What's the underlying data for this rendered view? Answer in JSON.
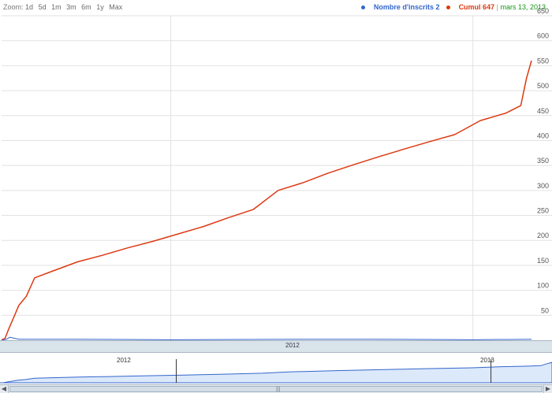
{
  "header": {
    "zoom_label": "Zoom:",
    "zoom_options": [
      "1d",
      "5d",
      "1m",
      "3m",
      "6m",
      "1y",
      "Max"
    ]
  },
  "legend": {
    "series": [
      {
        "label": "Nombre d'inscrits 2",
        "color": "#3366cc"
      },
      {
        "label": "Cumul 647",
        "color": "#dc3912"
      }
    ],
    "date": "mars 13, 2013"
  },
  "colors": {
    "grid": "#e2e2e2",
    "axis_text": "#555555",
    "overview_fill": "#dce9fb"
  },
  "main_axis": {
    "year_label": "2012"
  },
  "overview": {
    "labels": [
      "2012",
      "2013"
    ]
  },
  "chart_data": {
    "type": "line",
    "title": "",
    "xlabel": "",
    "ylabel": "",
    "ylim": [
      0,
      650
    ],
    "yticks": [
      50,
      100,
      150,
      200,
      250,
      300,
      350,
      400,
      450,
      500,
      550,
      600,
      650
    ],
    "grid": true,
    "legend_position": "top-right",
    "x_range": [
      "2011-06-10",
      "2013-03-13"
    ],
    "series": [
      {
        "name": "Cumul",
        "color": "#dc3912",
        "x": [
          "2011-06-10",
          "2011-06-14",
          "2011-06-18",
          "2011-07-01",
          "2011-07-10",
          "2011-07-20",
          "2011-08-10",
          "2011-09-10",
          "2011-10-10",
          "2011-11-10",
          "2011-12-10",
          "2012-01-10",
          "2012-02-10",
          "2012-03-10",
          "2012-04-10",
          "2012-05-10",
          "2012-06-10",
          "2012-07-10",
          "2012-08-10",
          "2012-09-10",
          "2012-10-10",
          "2012-11-10",
          "2012-12-10",
          "2013-01-10",
          "2013-02-10",
          "2013-02-28",
          "2013-03-07",
          "2013-03-13"
        ],
        "values": [
          1,
          3,
          20,
          70,
          88,
          125,
          138,
          157,
          170,
          185,
          198,
          213,
          228,
          245,
          262,
          300,
          316,
          335,
          352,
          368,
          383,
          398,
          412,
          440,
          455,
          470,
          525,
          560
        ],
        "linewidth": 1.5
      },
      {
        "name": "Nombre d'inscrits",
        "color": "#3366cc",
        "x": [
          "2011-06-10",
          "2011-06-16",
          "2011-06-20",
          "2011-07-01",
          "2011-09-01",
          "2012-01-01",
          "2012-06-01",
          "2012-09-01",
          "2013-01-01",
          "2013-03-13"
        ],
        "values": [
          0,
          2,
          6,
          2,
          2,
          1,
          2,
          2,
          1,
          2
        ],
        "linewidth": 1
      }
    ]
  }
}
